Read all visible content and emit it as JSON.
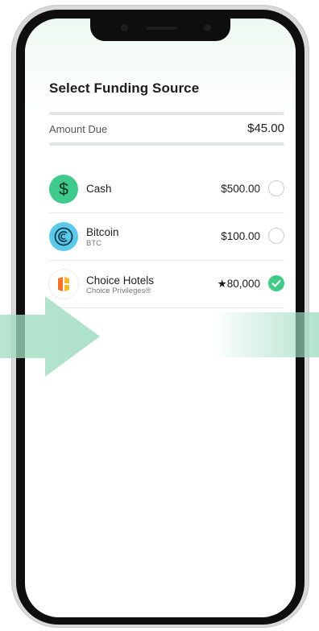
{
  "screen": {
    "title": "Select Funding Source"
  },
  "amount_due": {
    "label": "Amount Due",
    "value": "$45.00"
  },
  "funding_sources": [
    {
      "name": "Cash",
      "subtitle": "",
      "amount": "$500.00",
      "icon": "dollar-sign-icon",
      "selected": false
    },
    {
      "name": "Bitcoin",
      "subtitle": "BTC",
      "amount": "$100.00",
      "icon": "bitcoin-icon",
      "selected": false
    },
    {
      "name": "Choice Hotels",
      "subtitle": "Choice Privileges®",
      "amount": "★80,000",
      "icon": "choice-hotels-logo-icon",
      "selected": true
    }
  ],
  "colors": {
    "accent_green": "#3fca88",
    "cash_icon_bg": "#3fc98a",
    "bitcoin_icon_bg": "#5cc9ea",
    "arrow_green": "#9fdcc0"
  }
}
